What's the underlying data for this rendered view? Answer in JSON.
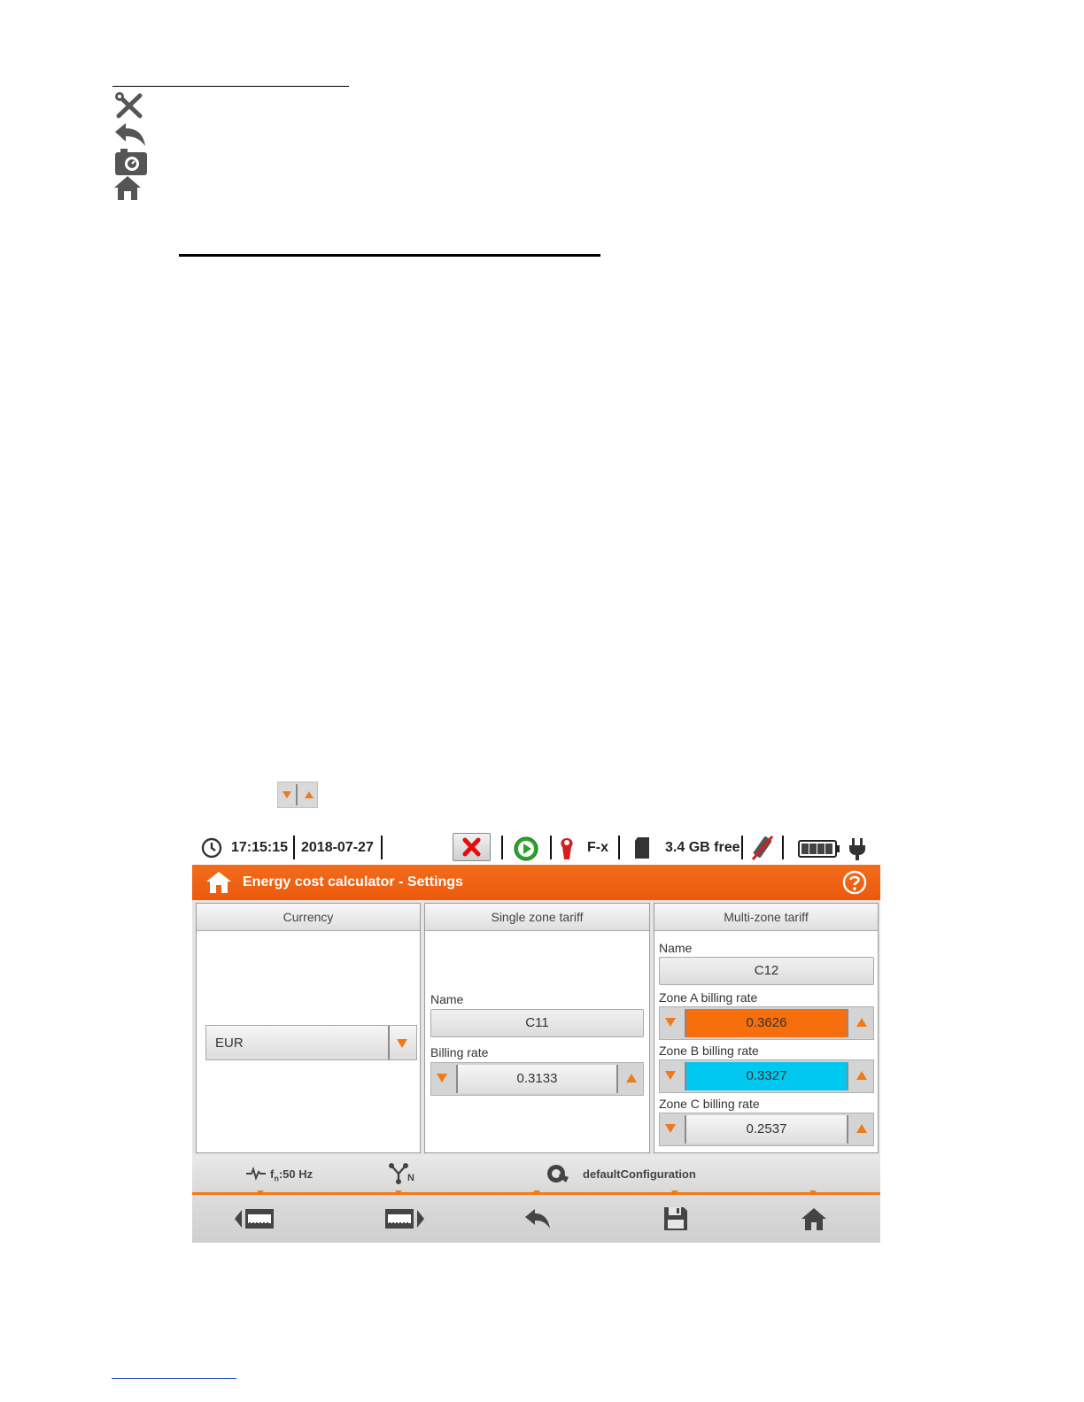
{
  "status": {
    "time": "17:15:15",
    "date": "2018-07-27",
    "probe": "F-x",
    "storage": "3.4 GB free"
  },
  "title": "Energy cost calculator - Settings",
  "currency": {
    "header": "Currency",
    "value": "EUR"
  },
  "single": {
    "header": "Single zone tariff",
    "name_label": "Name",
    "name": "C11",
    "rate_label": "Billing rate",
    "rate": "0.3133"
  },
  "multi": {
    "header": "Multi-zone tariff",
    "name_label": "Name",
    "name": "C12",
    "zone_a_label": "Zone A billing rate",
    "zone_a": "0.3626",
    "zone_b_label": "Zone B billing rate",
    "zone_b": "0.3327",
    "zone_c_label": "Zone C billing rate",
    "zone_c": "0.2537"
  },
  "info": {
    "freq_prefix": "f",
    "freq_sub": "n",
    "freq_suffix": ":50 Hz",
    "network_sub": "N",
    "config": "defaultConfiguration"
  },
  "colors": {
    "accent": "#f07a18",
    "zone_a": "#f76e0c",
    "zone_b": "#00c8f0"
  }
}
